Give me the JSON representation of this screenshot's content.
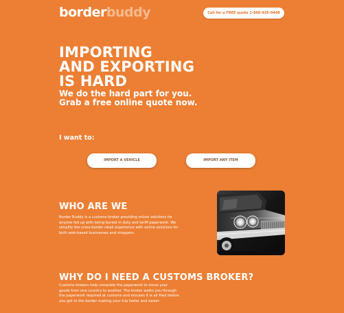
{
  "header": {
    "logo_part1": "border",
    "logo_part2": "buddy",
    "call_button": "Call for a FREE quote 1-866-926-0448"
  },
  "hero": {
    "title_lines": [
      "IMPORTING",
      "AND EXPORTING",
      "IS HARD"
    ],
    "subtitle_lines": [
      "We do the hard part for you.",
      "Grab a free online quote now."
    ]
  },
  "actions": {
    "label": "I want to:",
    "import_vehicle": "IMPORT A VEHICLE",
    "import_item": "IMPORT ANY ITEM"
  },
  "who": {
    "title": "WHO ARE WE",
    "body_lines": [
      "Border Buddy is a customs broker providing online solutions for",
      "anyone fed up with being buried in duty and tariff paperwork. We",
      "simplify the cross-border retail experience with online solutions for",
      "both web-based businesses and shoppers."
    ],
    "image": "classic-car-photo"
  },
  "why": {
    "title": "WHY DO I NEED A CUSTOMS BROKER?",
    "body_lines": [
      "Customs brokers help complete the paperwork to move your",
      "goods from one country to another. The broker walks you through",
      "the paperwork required at customs and ensures it is all filed before",
      "you get to the border making your trip faster and easier."
    ]
  },
  "colors": {
    "background": "#ec7f34",
    "text": "#ffffff",
    "logo_accent": "#f6b98c",
    "button_bg": "#ffffff"
  }
}
